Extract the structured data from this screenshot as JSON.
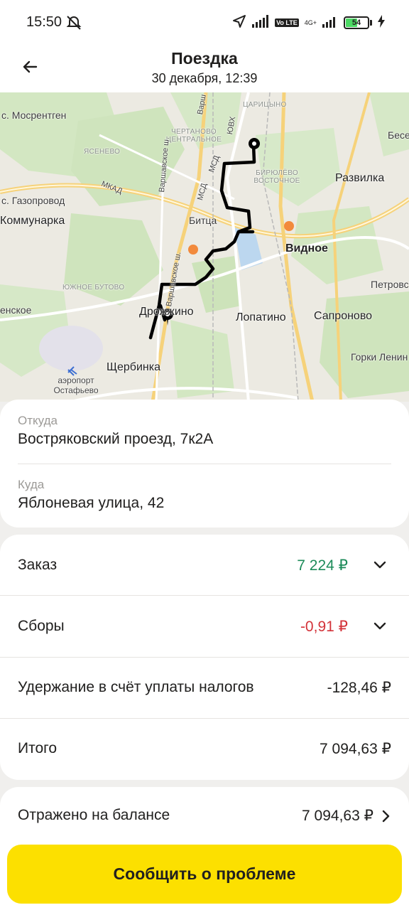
{
  "status_bar": {
    "time": "15:50",
    "battery": "54",
    "network": "4G+",
    "lte": "Vo LTE"
  },
  "header": {
    "title": "Поездка",
    "subtitle": "30 декабря, 12:39",
    "back_icon": "arrow-left-icon"
  },
  "map": {
    "labels": {
      "mosrentgen": "с. Мосрентген",
      "yasenevo": "ЯСЕНЕВО",
      "chertanovo": "ЧЕРТАНОВО ЦЕНТРАЛЬНОЕ",
      "tsaritsyno": "ЦАРИЦЫНО",
      "biryulevo": "БИРЮЛЁВО ВОСТОЧНОЕ",
      "bese": "Бесе",
      "razvilka": "Развилка",
      "mkad": "МКАД",
      "gazoprovod": "с. Газопровод",
      "kommunarka": "Коммунарка",
      "bitsa": "Битца",
      "vidnoe": "Видное",
      "petrovsk": "Петровс",
      "yuzhnoe_butovo": "ЮЖНОЕ БУТОВО",
      "enskoe": "енское",
      "drozhzhino": "Дрожжино",
      "lopatino": "Лопатино",
      "sapronovo": "Сапроново",
      "gorki": "Горки Ленин",
      "shcherbinka": "Щербинка",
      "airport": "аэропорт Остафьево",
      "varshavskoe_1": "Варшавское ш.",
      "varshavskoe_2": "Варшавское ш.",
      "msd_1": "МСД",
      "msd_2": "МСД",
      "varsh": "Варш",
      "yuvkh": "ЮВХ"
    }
  },
  "route": {
    "from_label": "Откуда",
    "from_value": "Востряковский проезд, 7к2А",
    "to_label": "Куда",
    "to_value": "Яблоневая улица, 42"
  },
  "payment": {
    "order_label": "Заказ",
    "order_value": "7 224 ₽",
    "fees_label": "Сборы",
    "fees_value": "-0,91 ₽",
    "tax_label": "Удержание в счёт уплаты налогов",
    "tax_value": "-128,46 ₽",
    "total_label": "Итого",
    "total_value": "7 094,63 ₽"
  },
  "balance": {
    "label": "Отражено на балансе",
    "value": "7 094,63 ₽"
  },
  "cta": {
    "label": "Сообщить о проблеме"
  },
  "colors": {
    "accent": "#fce000",
    "positive": "#1d8b5a",
    "negative": "#d3333a"
  }
}
